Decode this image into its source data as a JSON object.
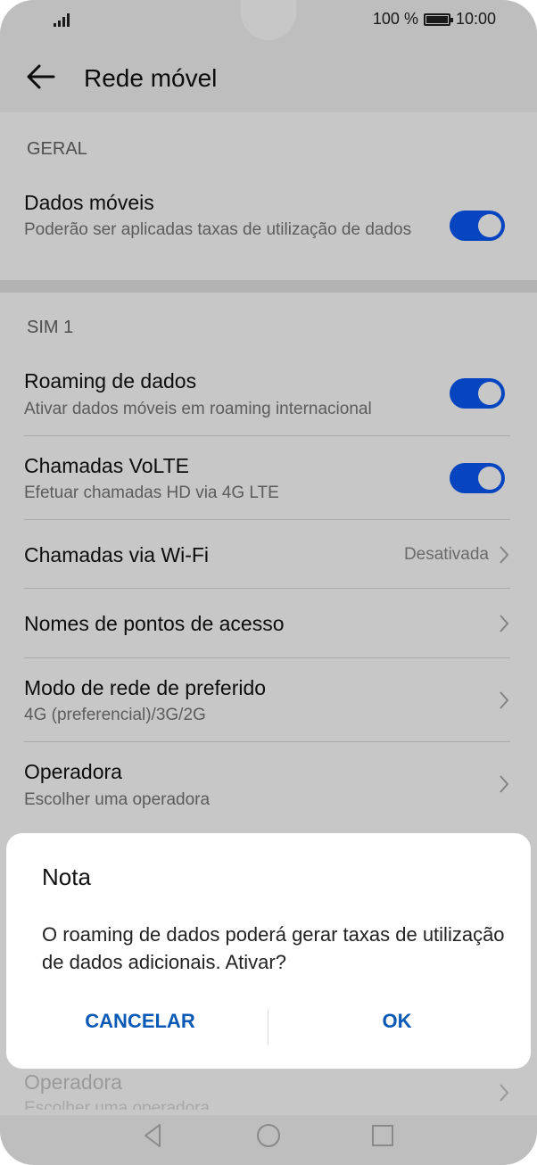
{
  "status": {
    "battery_text": "100 %",
    "time": "10:00"
  },
  "appbar": {
    "title": "Rede móvel"
  },
  "general": {
    "header": "GERAL",
    "mobile_data": {
      "title": "Dados móveis",
      "subtitle": "Poderão ser aplicadas taxas de utilização de dados",
      "enabled": true
    }
  },
  "sim1": {
    "header": "SIM 1",
    "items": [
      {
        "title": "Roaming de dados",
        "subtitle": "Ativar dados móveis em roaming internacional",
        "enabled": true
      },
      {
        "title": "Chamadas VoLTE",
        "subtitle": "Efetuar chamadas HD via 4G LTE",
        "enabled": true
      },
      {
        "title": "Chamadas via Wi-Fi",
        "value": "Desativada"
      },
      {
        "title": "Nomes de pontos de acesso"
      },
      {
        "title": "Modo de rede de preferido",
        "subtitle": "4G (preferencial)/3G/2G"
      },
      {
        "title": "Operadora",
        "subtitle": "Escolher uma operadora"
      }
    ]
  },
  "dialog": {
    "title": "Nota",
    "message": "O roaming de dados poderá gerar taxas de utilização de dados adicionais. Ativar?",
    "cancel_label": "CANCELAR",
    "ok_label": "OK"
  },
  "peek": {
    "title": "Operadora",
    "subtitle": "Escolher uma operadora"
  },
  "colors": {
    "accent": "#0a59f7",
    "dialog_button": "#0a59b5"
  },
  "icons": {
    "back": "arrow-left-icon",
    "chevron": "chevron-right-icon",
    "nav": [
      "back-triangle-icon",
      "home-circle-icon",
      "recents-square-icon"
    ]
  }
}
